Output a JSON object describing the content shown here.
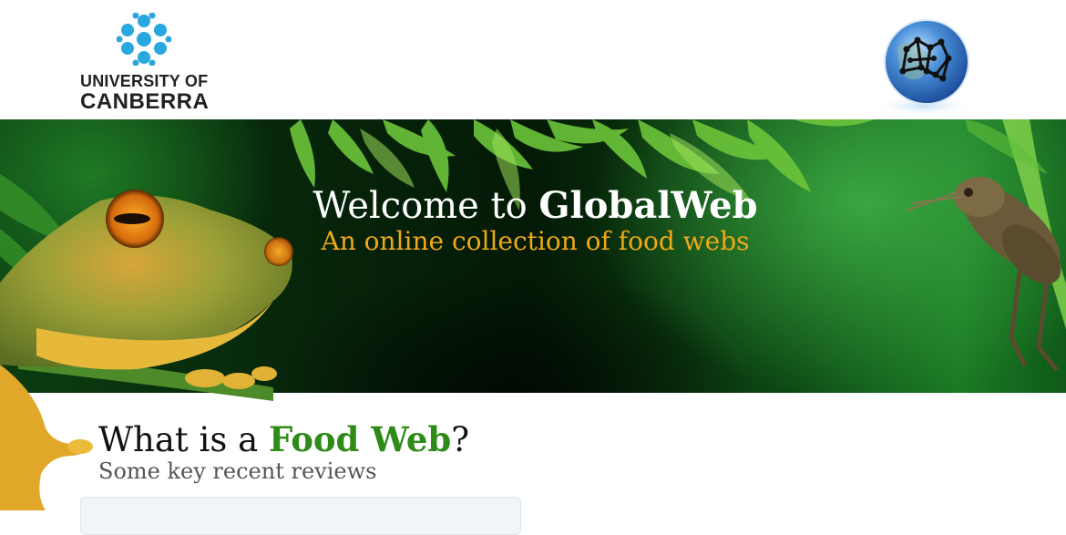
{
  "header": {
    "university": {
      "line1": "UNIVERSITY OF",
      "line2": "CANBERRA"
    },
    "logo_icon": "university-crest-icon",
    "globe_icon": "food-web-globe-icon"
  },
  "banner": {
    "welcome_prefix": "Welcome to ",
    "site_name": "GlobalWeb",
    "tagline": "An online collection of food webs"
  },
  "section": {
    "title_prefix": "What is a ",
    "title_highlight": "Food Web",
    "title_suffix": "?",
    "subtitle": "Some key recent reviews"
  },
  "colors": {
    "tagline": "#f0a818",
    "highlight": "#2e8b17",
    "banner_dark": "#041a06"
  }
}
